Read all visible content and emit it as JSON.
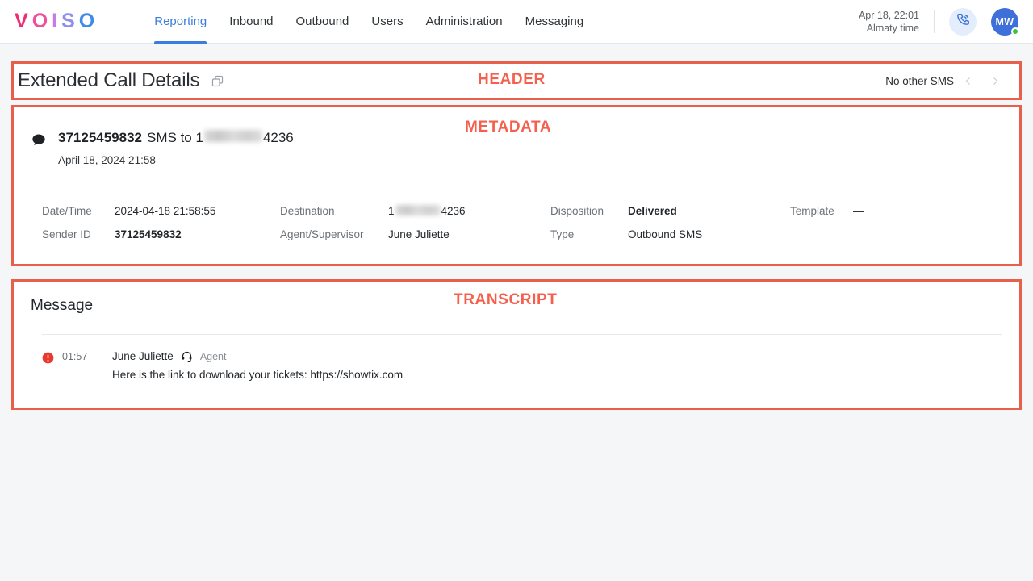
{
  "brand": {
    "logo_letters": [
      {
        "char": "V",
        "color": "#ef2c72"
      },
      {
        "char": "O",
        "color": "#f0509b"
      },
      {
        "char": "I",
        "color": "#c37ce8"
      },
      {
        "char": "S",
        "color": "#8e8df0"
      },
      {
        "char": "O",
        "color": "#3f8bea"
      }
    ]
  },
  "nav": {
    "items": [
      {
        "label": "Reporting",
        "active": true
      },
      {
        "label": "Inbound",
        "active": false
      },
      {
        "label": "Outbound",
        "active": false
      },
      {
        "label": "Users",
        "active": false
      },
      {
        "label": "Administration",
        "active": false
      },
      {
        "label": "Messaging",
        "active": false
      }
    ]
  },
  "topbar": {
    "clock_date": "Apr 18, 22:01",
    "clock_zone": "Almaty time",
    "phone_icon": "phone-call-icon",
    "avatar_initials": "MW",
    "status": "online"
  },
  "annotations": [
    {
      "label": "HEADER"
    },
    {
      "label": "METADATA"
    },
    {
      "label": "TRANSCRIPT"
    }
  ],
  "header": {
    "title": "Extended Call Details",
    "copy_icon": "copy-icon",
    "no_other_text": "No other SMS",
    "prev_icon": "chevron-left-icon",
    "next_icon": "chevron-right-icon"
  },
  "metadata": {
    "bubble_icon": "chat-bubble-icon",
    "sms_sender": "37125459832",
    "sms_summary": "SMS to 1",
    "sms_destination_suffix": "4236",
    "sms_datetime": "April 18, 2024  21:58",
    "fields": {
      "datetime_label": "Date/Time",
      "datetime_value": "2024-04-18  21:58:55",
      "destination_label": "Destination",
      "destination_prefix": "1",
      "destination_suffix": "4236",
      "disposition_label": "Disposition",
      "disposition_value": "Delivered",
      "template_label": "Template",
      "template_value": "—",
      "sender_id_label": "Sender ID",
      "sender_id_value": "37125459832",
      "agent_label": "Agent/Supervisor",
      "agent_value": "June Juliette",
      "type_label": "Type",
      "type_value": "Outbound SMS"
    }
  },
  "transcript": {
    "title": "Message",
    "entry": {
      "status_icon": "alert-circle-icon",
      "time": "01:57",
      "author": "June Juliette",
      "role_icon": "headset-icon",
      "role": "Agent",
      "text": "Here is the link to download your tickets: https://showtix.com"
    }
  },
  "colors": {
    "accent": "#3b7ddd",
    "annotation": "#e8604c",
    "alert": "#e8392f",
    "online": "#3ec13e"
  }
}
